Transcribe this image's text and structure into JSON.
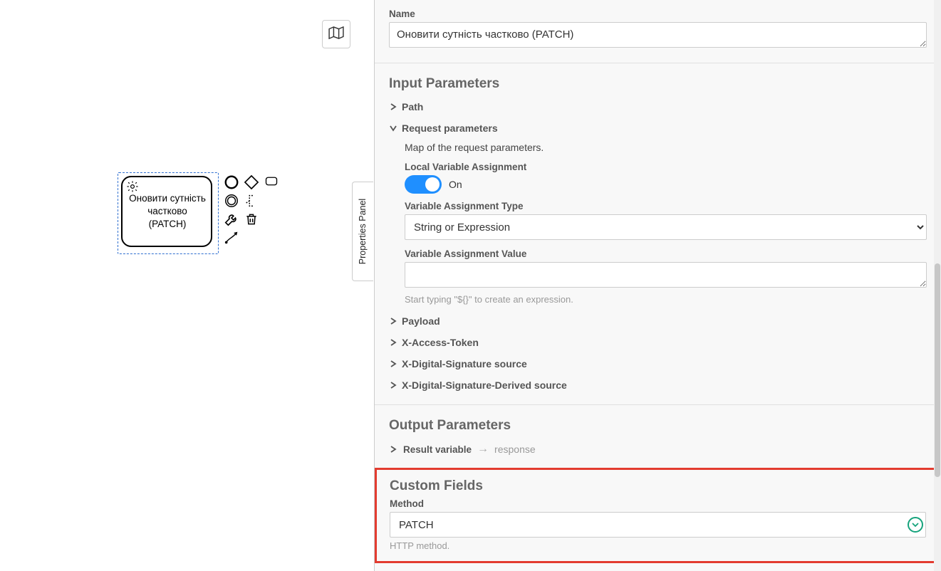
{
  "canvas": {
    "node_label": "Оновити сутність частково (PATCH)"
  },
  "panel_tab": "Properties Panel",
  "name": {
    "label": "Name",
    "value": "Оновити сутність частково (PATCH)"
  },
  "input_params": {
    "title": "Input Parameters",
    "path_label": "Path",
    "request_params_label": "Request parameters",
    "request_params_desc": "Map of the request parameters.",
    "local_var_label": "Local Variable Assignment",
    "local_var_state": "On",
    "var_type_label": "Variable Assignment Type",
    "var_type_value": "String or Expression",
    "var_value_label": "Variable Assignment Value",
    "var_value_value": "",
    "var_value_hint": "Start typing \"${}\" to create an expression.",
    "payload_label": "Payload",
    "xaccess_label": "X-Access-Token",
    "xdigsig_label": "X-Digital-Signature source",
    "xdigsigd_label": "X-Digital-Signature-Derived source"
  },
  "output_params": {
    "title": "Output Parameters",
    "result_var_label": "Result variable",
    "result_var_value": "response"
  },
  "custom_fields": {
    "title": "Custom Fields",
    "method_label": "Method",
    "method_value": "PATCH",
    "method_hint": "HTTP method."
  }
}
